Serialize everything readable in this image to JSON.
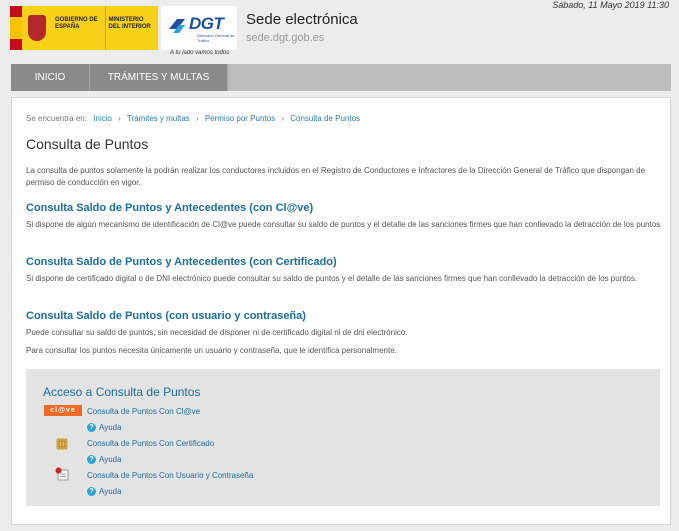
{
  "header": {
    "gov_logo_text_1": "GOBIERNO DE ESPAÑA",
    "gov_logo_text_2": "MINISTERIO DEL INTERIOR",
    "dgt_logo": "DGT",
    "dgt_logo_sub": "Dirección General de Tráfico",
    "tagline": "A tu lado vamos todos",
    "site_title": "Sede electrónica",
    "site_url": "sede.dgt.gob.es",
    "datetime": "Sábado, 11 Mayo 2019 11:30"
  },
  "nav": {
    "items": [
      {
        "label": "INICIO"
      },
      {
        "label": "TRÁMITES Y MULTAS"
      }
    ]
  },
  "breadcrumb": {
    "prefix": "Se encuentra en:",
    "items": [
      "Inicio",
      "Trámites y multas",
      "Permiso por Puntos",
      "Consulta de Puntos"
    ]
  },
  "page": {
    "title": "Consulta de Puntos",
    "intro": "La consulta de puntos solamente la podrán realizar los conductores incluidos en el Registro de Conductores e Infractores de la Dirección General de Tráfico que dispongan de permiso de conducción en vigor."
  },
  "sections": [
    {
      "title": "Consulta Saldo de Puntos y Antecedentes (con Cl@ve)",
      "text": "Si dispone de algún mecanismo de identificación de Cl@ve puede consultar su saldo de puntos y el detalle de las sanciones firmes que han conllevado la detracción de los puntos"
    },
    {
      "title": "Consulta Saldo de Puntos y Antecedentes (con Certificado)",
      "text": "Si dispone de certificado digital o de DNI electrónico puede consultar su saldo de puntos y el detalle de las sanciones firmes que han conllevado la detracción de los puntos."
    },
    {
      "title": "Consulta Saldo de Puntos (con usuario y contraseña)",
      "text": "Puede consultar su saldo de puntos, sin necesidad de disponer ni de certificado digital ni de dni electrónico.",
      "text2": "Para consultar los puntos necesita únicamente un usuario y contraseña, que le identifica personalmente."
    }
  ],
  "access": {
    "title": "Acceso a Consulta de Puntos",
    "clave_logo": "cl@ve",
    "links": [
      {
        "label": "Consulta de Puntos Con Cl@ve",
        "help": "Ayuda",
        "icon": "clave-logo-icon"
      },
      {
        "label": "Consulta de Puntos Con Certificado",
        "help": "Ayuda",
        "icon": "certificate-card-icon"
      },
      {
        "label": "Consulta de Puntos Con Usuario y Contraseña",
        "help": "Ayuda",
        "icon": "user-password-icon"
      }
    ]
  },
  "colors": {
    "link": "#1a6e9e",
    "nav_active": "#8a8a8a",
    "clave_orange": "#ee6a25",
    "help_blue": "#2aa3d6"
  }
}
